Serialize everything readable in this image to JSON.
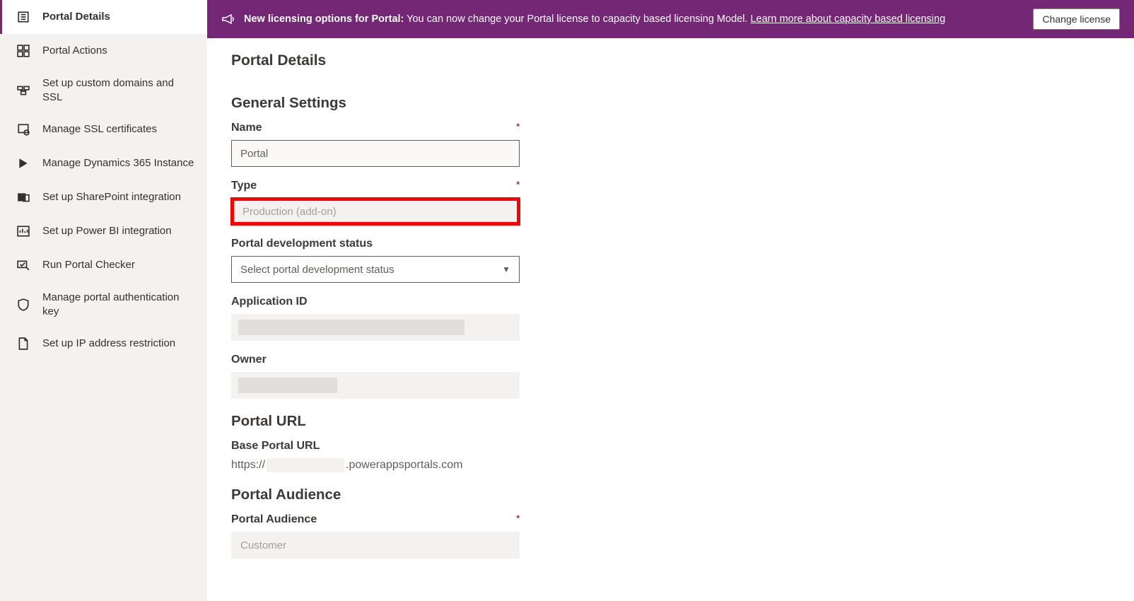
{
  "notification": {
    "title": "New licensing options for Portal:",
    "message": " You can now change your Portal license to capacity based licensing Model. ",
    "link_text": "Learn more about capacity based licensing",
    "button_label": "Change license"
  },
  "sidebar": {
    "items": [
      {
        "label": "Portal Details",
        "active": true
      },
      {
        "label": "Portal Actions"
      },
      {
        "label": "Set up custom domains and SSL"
      },
      {
        "label": "Manage SSL certificates"
      },
      {
        "label": "Manage Dynamics 365 Instance"
      },
      {
        "label": "Set up SharePoint integration"
      },
      {
        "label": "Set up Power BI integration"
      },
      {
        "label": "Run Portal Checker"
      },
      {
        "label": "Manage portal authentication key"
      },
      {
        "label": "Set up IP address restriction"
      }
    ]
  },
  "page": {
    "title": "Portal Details",
    "sections": {
      "general": {
        "heading": "General Settings",
        "name_label": "Name",
        "name_value": "Portal",
        "type_label": "Type",
        "type_value": "Production (add-on)",
        "dev_status_label": "Portal development status",
        "dev_status_placeholder": "Select portal development status",
        "app_id_label": "Application ID",
        "owner_label": "Owner"
      },
      "url": {
        "heading": "Portal URL",
        "base_url_label": "Base Portal URL",
        "base_url_prefix": "https://",
        "base_url_suffix": ".powerappsportals.com"
      },
      "audience": {
        "heading": "Portal Audience",
        "audience_label": "Portal Audience",
        "audience_value": "Customer"
      }
    }
  }
}
